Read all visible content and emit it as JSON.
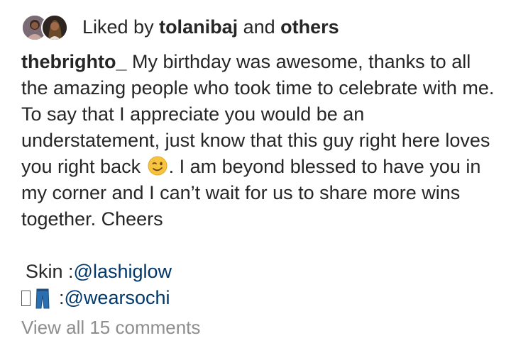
{
  "liked": {
    "prefix": "Liked by ",
    "user": "tolanibaj",
    "middle": " and ",
    "others": "others"
  },
  "post": {
    "username": "thebrighto_",
    "caption_part1": " My birthday was awesome, thanks to all the amazing people who took time to celebrate with me. To say that I appreciate you would be an understatement, just know that this guy right here loves you right back ",
    "caption_part2": ". I am beyond blessed to have you in my corner and I can’t wait for us to share more wins together. Cheers"
  },
  "tags": {
    "skin_label": "Skin : ",
    "skin_handle": "@lashiglow",
    "clothing_label": ": ",
    "clothing_handle": "@wearsochi"
  },
  "comments": {
    "view_all": "View all 15 comments"
  },
  "icons": {
    "emoji": "winking-face-emoji",
    "clothing": "jeans-emoji",
    "missing": "missing-glyph-box"
  },
  "colors": {
    "text": "#262626",
    "mention": "#00376b",
    "muted": "#8e8e8e"
  }
}
